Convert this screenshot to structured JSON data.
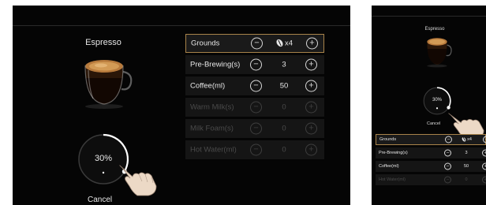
{
  "product": "Espresso",
  "progress_percent": 30,
  "progress_label": "30%",
  "cancel_label": "Cancel",
  "settings": [
    {
      "label": "Grounds",
      "value": "x4",
      "icon": "coffee-bean-icon",
      "active": true,
      "enabled": true
    },
    {
      "label": "Pre-Brewing(s)",
      "value": "3",
      "active": false,
      "enabled": true
    },
    {
      "label": "Coffee(ml)",
      "value": "50",
      "active": false,
      "enabled": true
    },
    {
      "label": "Warm Milk(s)",
      "value": "0",
      "active": false,
      "enabled": false
    },
    {
      "label": "Milk Foam(s)",
      "value": "0",
      "active": false,
      "enabled": false
    },
    {
      "label": "Hot Water(ml)",
      "value": "0",
      "active": false,
      "enabled": false
    }
  ],
  "small_screen_visible_rows": 4,
  "colors": {
    "background": "#050505",
    "row": "#151515",
    "active_border": "#a8834a",
    "text": "#e6e6e6",
    "disabled": "#4a4a4a"
  }
}
